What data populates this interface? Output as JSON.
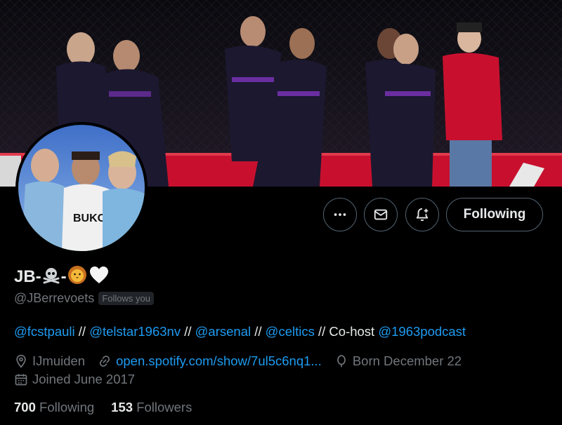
{
  "profile": {
    "display_name_prefix": "JB-",
    "display_name_mid": "-",
    "handle": "@JBerrevoets",
    "follows_you": "Follows you",
    "name_icons": [
      "skull-crossbones-icon",
      "lion-face-icon",
      "white-heart-icon"
    ]
  },
  "actions": {
    "more_icon": "more-horizontal-icon",
    "message_icon": "mail-icon",
    "notify_icon": "bell-plus-icon",
    "following_label": "Following"
  },
  "bio": {
    "parts": [
      {
        "text": "@fcstpauli",
        "link": true
      },
      {
        "text": " // ",
        "link": false
      },
      {
        "text": "@telstar1963nv",
        "link": true
      },
      {
        "text": " // ",
        "link": false
      },
      {
        "text": "@arsenal",
        "link": true
      },
      {
        "text": " // ",
        "link": false
      },
      {
        "text": "@celtics",
        "link": true
      },
      {
        "text": " // Co-host ",
        "link": false
      },
      {
        "text": "@1963podcast",
        "link": true
      }
    ]
  },
  "meta": {
    "location": "IJmuiden",
    "website": "open.spotify.com/show/7ul5c6nq1...",
    "birthday": "Born December 22",
    "joined": "Joined June 2017"
  },
  "stats": {
    "following_count": "700",
    "following_label": "Following",
    "followers_count": "153",
    "followers_label": "Followers"
  },
  "colors": {
    "accent": "#1d9bf0",
    "muted": "#71767b",
    "text": "#e7e9ea",
    "border": "#536471",
    "background": "#000000"
  }
}
